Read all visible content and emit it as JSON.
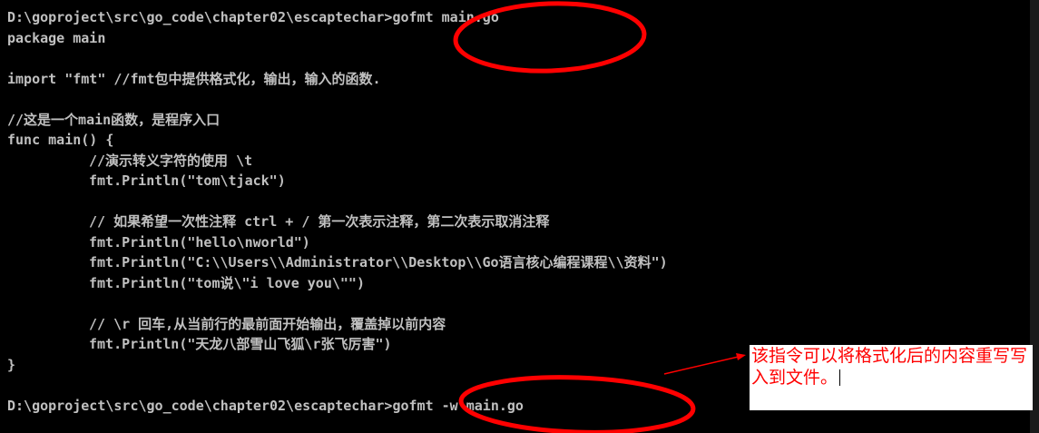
{
  "console": {
    "lines": [
      "D:\\goproject\\src\\go_code\\chapter02\\escaptechar>gofmt main.go",
      "package main",
      "",
      "import \"fmt\" //fmt包中提供格式化，输出，输入的函数.",
      "",
      "//这是一个main函数，是程序入口",
      "func main() {",
      "//演示转义字符的使用 \\t",
      "fmt.Println(\"tom\\tjack\")",
      "",
      "// 如果希望一次性注释 ctrl + / 第一次表示注释，第二次表示取消注释",
      "fmt.Println(\"hello\\nworld\")",
      "fmt.Println(\"C:\\\\Users\\\\Administrator\\\\Desktop\\\\Go语言核心编程课程\\\\资料\")",
      "fmt.Println(\"tom说\\\"i love you\\\"\")",
      "",
      "// \\r 回车,从当前行的最前面开始输出，覆盖掉以前内容",
      "fmt.Println(\"天龙八部雪山飞狐\\r张飞厉害\")",
      "}",
      "",
      "D:\\goproject\\src\\go_code\\chapter02\\escaptechar>gofmt -w main.go"
    ]
  },
  "annotation": {
    "text": "该指令可以将格式化后的内容重写写入到文件。"
  },
  "colors": {
    "background": "#000000",
    "text": "#c0c0c0",
    "mark": "#ff0000",
    "annotation_bg": "#ffffff"
  }
}
